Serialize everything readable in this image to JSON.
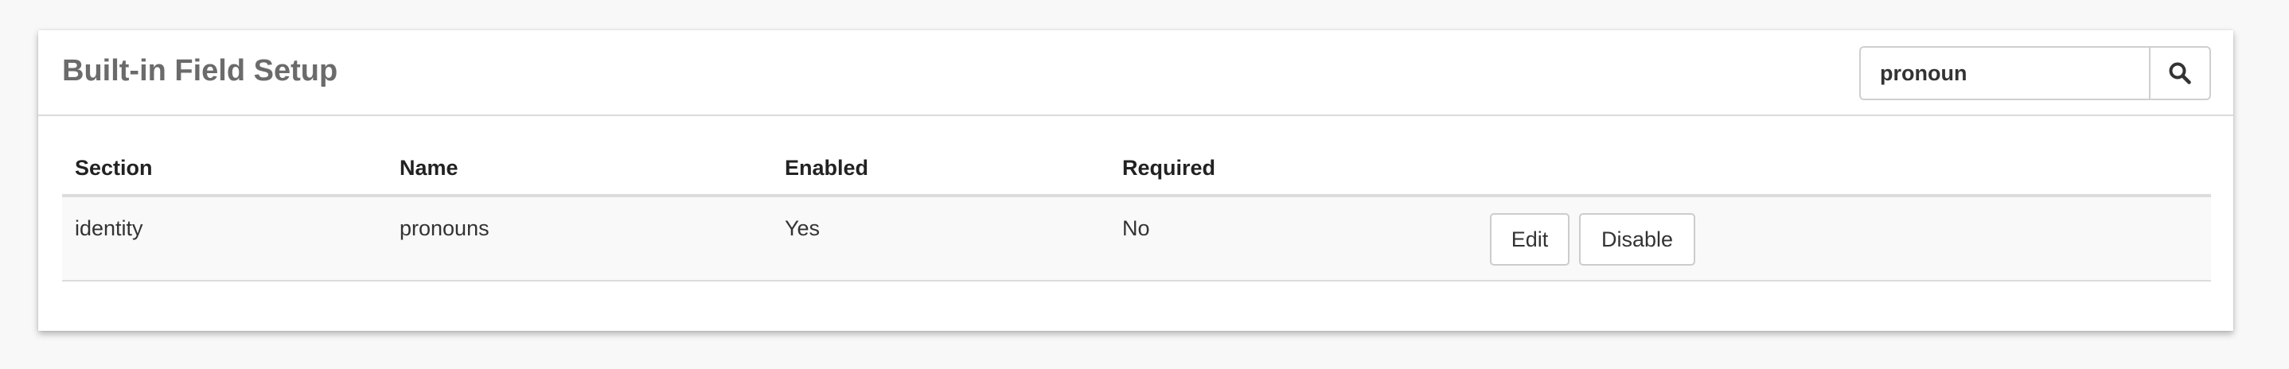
{
  "panel": {
    "title": "Built-in Field Setup"
  },
  "search": {
    "value": "pronoun",
    "icon": "search-icon"
  },
  "table": {
    "columns": [
      "Section",
      "Name",
      "Enabled",
      "Required"
    ],
    "rows": [
      {
        "section": "identity",
        "name": "pronouns",
        "enabled": "Yes",
        "required": "No",
        "actions": {
          "edit_label": "Edit",
          "disable_label": "Disable"
        }
      }
    ]
  }
}
